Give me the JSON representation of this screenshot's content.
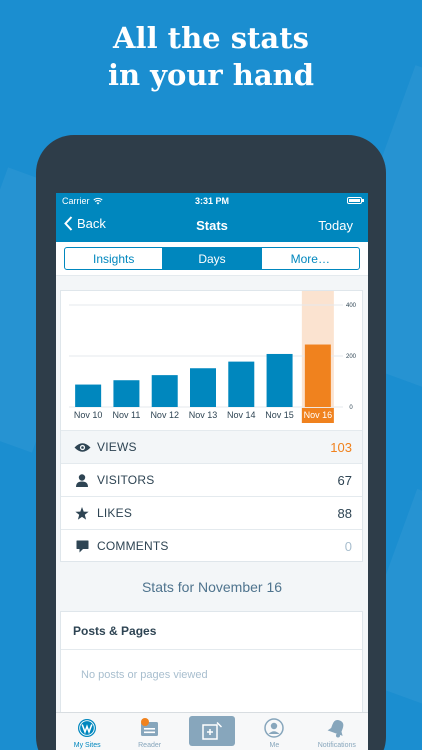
{
  "headline": {
    "line1": "All the stats",
    "line2": "in your hand"
  },
  "status_bar": {
    "carrier": "Carrier",
    "time": "3:31 PM"
  },
  "nav": {
    "back_label": "Back",
    "title": "Stats",
    "right_label": "Today"
  },
  "segments": [
    {
      "label": "Insights",
      "active": false
    },
    {
      "label": "Days",
      "active": true
    },
    {
      "label": "More…",
      "active": false
    }
  ],
  "chart_data": {
    "type": "bar",
    "categories": [
      "Nov 10",
      "Nov 11",
      "Nov 12",
      "Nov 13",
      "Nov 14",
      "Nov 15",
      "Nov 16"
    ],
    "values": [
      88,
      105,
      125,
      152,
      178,
      208,
      245
    ],
    "selected_index": 6,
    "ylim": [
      0,
      400
    ],
    "yticks": [
      0,
      200,
      400
    ],
    "colors": {
      "bar": "#0087be",
      "selected": "#f0821e",
      "highlight": "#fbe3d0",
      "grid": "#e4eaee"
    }
  },
  "stats": [
    {
      "icon": "eye-icon",
      "label": "VIEWS",
      "value": "103",
      "style": "orange"
    },
    {
      "icon": "person-icon",
      "label": "VISITORS",
      "value": "67",
      "style": ""
    },
    {
      "icon": "star-icon",
      "label": "LIKES",
      "value": "88",
      "style": ""
    },
    {
      "icon": "comment-icon",
      "label": "COMMENTS",
      "value": "0",
      "style": "grey"
    }
  ],
  "stats_for": "Stats for November 16",
  "posts": {
    "title": "Posts & Pages",
    "empty": "No posts or pages viewed"
  },
  "tabs": [
    {
      "label": "My Sites",
      "icon": "wordpress-icon",
      "active": true
    },
    {
      "label": "Reader",
      "icon": "reader-icon",
      "active": false
    },
    {
      "label": "",
      "icon": "new-post-icon",
      "active": false
    },
    {
      "label": "Me",
      "icon": "avatar-icon",
      "active": false
    },
    {
      "label": "Notifications",
      "icon": "bell-icon",
      "active": false
    }
  ],
  "colors": {
    "brand": "#0087be",
    "background": "#1b8ed0",
    "accent": "#f0821e"
  }
}
